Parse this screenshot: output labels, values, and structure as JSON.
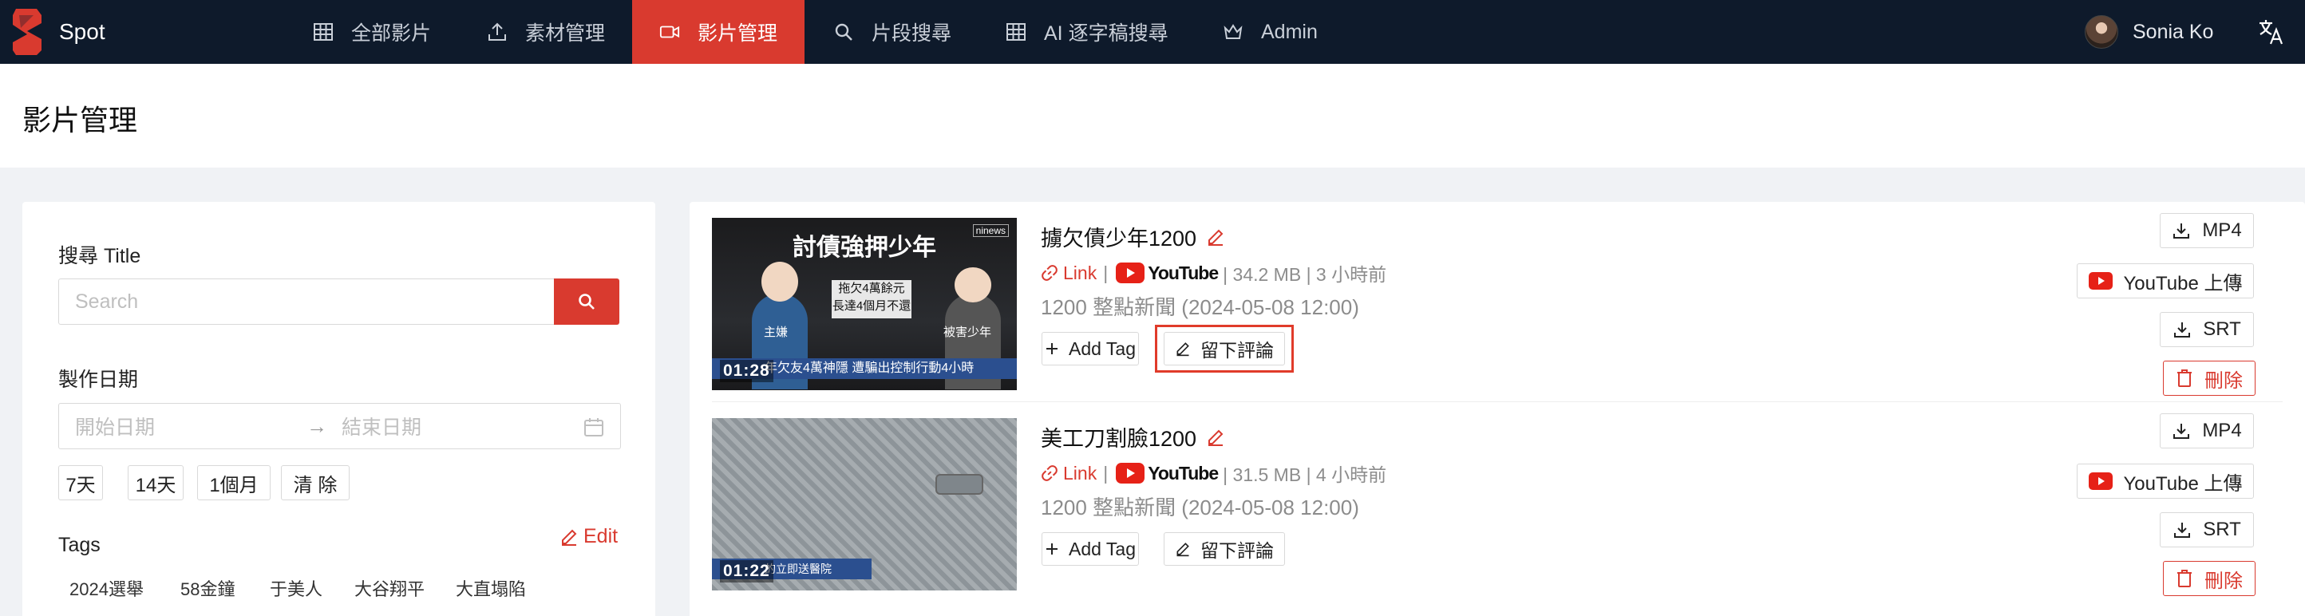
{
  "nav": {
    "brand": "Spot",
    "items": [
      {
        "label": "全部影片",
        "icon": "grid-icon"
      },
      {
        "label": "素材管理",
        "icon": "upload-icon"
      },
      {
        "label": "影片管理",
        "icon": "video-icon",
        "active": true
      },
      {
        "label": "片段搜尋",
        "icon": "search-icon"
      },
      {
        "label": "AI 逐字稿搜尋",
        "icon": "grid-icon"
      },
      {
        "label": "Admin",
        "icon": "crown-icon"
      }
    ],
    "user": "Sonia Ko",
    "language_icon": "translate-icon"
  },
  "page": {
    "title": "影片管理"
  },
  "sidebar": {
    "search_label": "搜尋 Title",
    "search_placeholder": "Search",
    "date_label": "製作日期",
    "date_start_placeholder": "開始日期",
    "date_end_placeholder": "結束日期",
    "quick_ranges": [
      "7天",
      "14天",
      "1個月",
      "清 除"
    ],
    "tags_label": "Tags",
    "edit_label": "Edit",
    "tags": [
      "2024選舉",
      "58金鐘",
      "于美人",
      "大谷翔平",
      "大直塌陷"
    ]
  },
  "videos": [
    {
      "title": "擄欠債少年1200",
      "link_label": "Link",
      "platform": "YouTube",
      "meta": "| 34.2 MB | 3 小時前",
      "subtitle": "1200 整點新聞 (2024-05-08 12:00)",
      "duration": "01:28",
      "thumb_heading": "討債強押少年",
      "thumb_caption": "年欠友4萬神隱 遭騙出控制行動4小時",
      "thumb_box": "拖欠4萬餘元\n長達4個月不還",
      "thumb_left": "主嫌",
      "thumb_right": "被害少年",
      "thumb_badge": "ninews",
      "add_tag": "Add Tag",
      "comment": "留下評論",
      "comment_highlighted": true
    },
    {
      "title": "美工刀割臉1200",
      "link_label": "Link",
      "platform": "YouTube",
      "meta": "| 31.5 MB | 4 小時前",
      "subtitle": "1200 整點新聞 (2024-05-08 12:00)",
      "duration": "01:22",
      "thumb_caption": "的立即送醫院",
      "add_tag": "Add Tag",
      "comment": "留下評論",
      "comment_highlighted": false
    }
  ],
  "actions": {
    "mp4": "MP4",
    "youtube_upload": "YouTube 上傳",
    "srt": "SRT",
    "delete": "刪除"
  },
  "colors": {
    "accent": "#d93a2f",
    "nav_bg": "#0e1a2b"
  }
}
